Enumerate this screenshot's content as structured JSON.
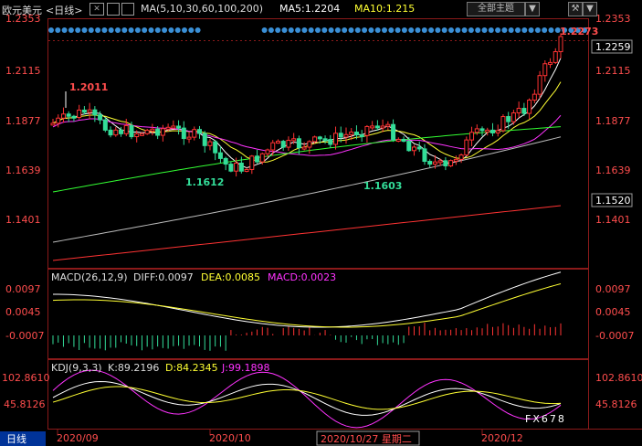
{
  "header": {
    "instrument": "欧元美元",
    "period": "<日线>",
    "ma_params": "MA(5,10,30,60,100,200)",
    "ma5": "MA5:1.2204",
    "ma10": "MA10:1.215",
    "btn_all": "全部主题",
    "btn_down": "▼",
    "btn_wrench": "⚒"
  },
  "main_axis": {
    "left_ticks": [
      "1.2353",
      "1.2115",
      "1.1877",
      "1.1639",
      "1.1401"
    ],
    "right_ticks": [
      "1.2353",
      "1.2115",
      "1.1877",
      "1.1639",
      "1.1401"
    ],
    "last_price_label": "1.2259",
    "level_label": "1.1520",
    "high_marker": "1.2273",
    "annot_high": "1.2011",
    "annot_low1": "1.1612",
    "annot_low2": "1.1603"
  },
  "macd": {
    "title": "MACD(26,12,9)",
    "diff": "DIFF:0.0097",
    "dea": "DEA:0.0085",
    "macd": "MACD:0.0023",
    "ticks": [
      "0.0097",
      "0.0045",
      "-0.0007"
    ]
  },
  "kdj": {
    "title": "KDJ(9,3,3)",
    "k": "K:89.2196",
    "d": "D:84.2345",
    "j": "J:99.1898",
    "ticks": [
      "102.8610",
      "45.8126"
    ]
  },
  "xaxis": {
    "left_label": "日线",
    "labels": [
      "2020/09",
      "2020/10",
      "2020/10/27 星期二",
      "2020/12"
    ]
  },
  "watermark": "FX678",
  "colors": {
    "up": "#ff3333",
    "down": "#33dd99",
    "ma5": "#ffffff",
    "ma10": "#ffff33",
    "ma30": "#ff33ff",
    "ma60": "#33ff33",
    "ma100": "#bbbbbb",
    "ma200": "#ff3333",
    "accent": "#ff4d4d"
  }
}
